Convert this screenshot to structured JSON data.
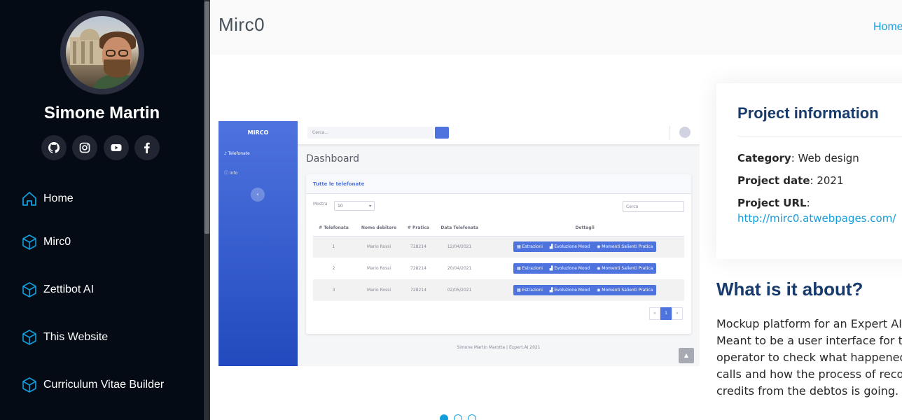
{
  "sidebar": {
    "profile_name": "Simone Martin",
    "social": [
      {
        "icon": "github-icon"
      },
      {
        "icon": "instagram-icon"
      },
      {
        "icon": "youtube-icon"
      },
      {
        "icon": "facebook-icon"
      }
    ],
    "nav": [
      {
        "label": "Home",
        "icon": "home-icon"
      },
      {
        "label": "Mirc0",
        "icon": "box-icon"
      },
      {
        "label": "Zettibot AI",
        "icon": "box-icon"
      },
      {
        "label": "This Website",
        "icon": "box-icon"
      },
      {
        "label": "Curriculum Vitae Builder",
        "icon": "box-icon"
      }
    ]
  },
  "header": {
    "title": "Mirc0",
    "breadcrumb_home": "Home"
  },
  "screenshot": {
    "brand": "MIRCO",
    "nav_item_1": "Telefonate",
    "nav_item_2": "Info",
    "search_placeholder": "Cerca...",
    "heading": "Dashboard",
    "card_title": "Tutte le telefonate",
    "show_label": "Mostra",
    "show_value": "10",
    "filter_placeholder": "Cerca",
    "columns": [
      "# Telefonata",
      "Nome debitore",
      "# Pratica",
      "Data Telefonata",
      "Dettagli"
    ],
    "rows": [
      {
        "num": "1",
        "name": "Mario Rossi",
        "pratica": "728214",
        "date": "12/04/2021"
      },
      {
        "num": "2",
        "name": "Mario Rossi",
        "pratica": "728214",
        "date": "20/04/2021"
      },
      {
        "num": "3",
        "name": "Mario Rossi",
        "pratica": "728214",
        "date": "02/05/2021"
      }
    ],
    "buttons": [
      "Estrazioni",
      "Evoluzione Mood",
      "Momenti Salienti Pratica"
    ],
    "pager": [
      "«",
      "1",
      "»"
    ],
    "footer": "Simone Martin Marotta | Expert.AI 2021"
  },
  "carousel": {
    "count": 3,
    "active": 0
  },
  "project_info": {
    "title": "Project information",
    "category_label": "Category",
    "category_value": "Web design",
    "date_label": "Project date",
    "date_value": "2021",
    "url_label": "Project URL",
    "url_value": "http://mirc0.atwebpages.com/"
  },
  "about": {
    "title": "What is it about?",
    "lines": [
      "Mockup platform for an Expert AI pr",
      "Meant to be a user interface for the",
      "operator to check what happened in",
      "calls and how the process of recove",
      "credits from the debtos is going."
    ]
  },
  "colors": {
    "accent": "#149ddd",
    "sidebar_bg": "#040b14",
    "heading": "#173b6c"
  }
}
